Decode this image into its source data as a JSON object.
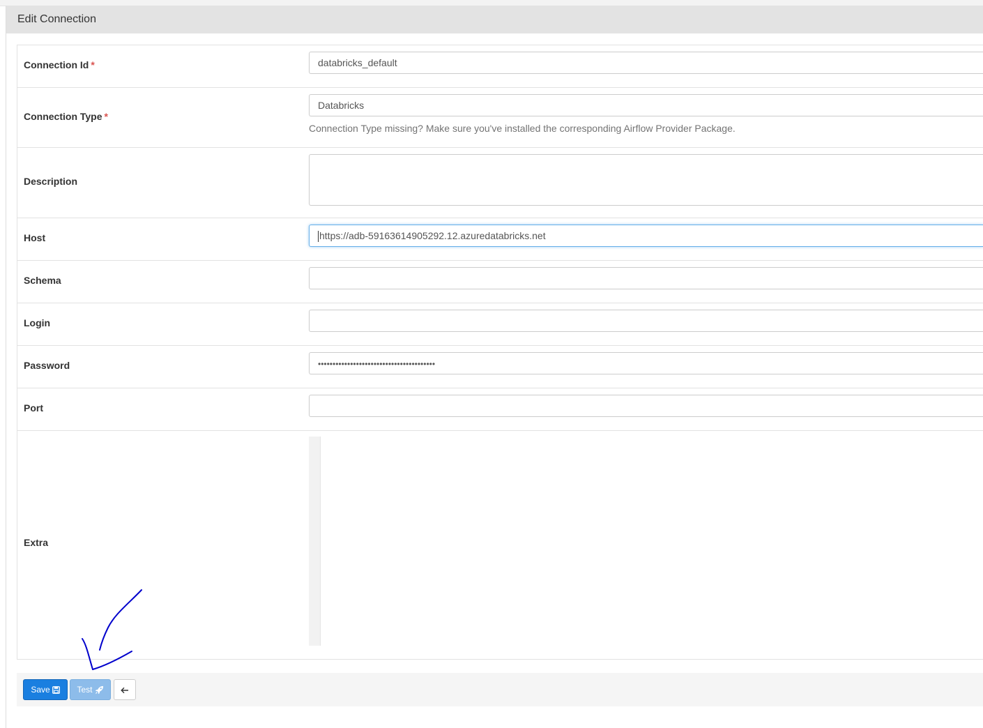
{
  "panel": {
    "title": "Edit Connection"
  },
  "fields": {
    "connection_id": {
      "label": "Connection Id",
      "required": "*",
      "value": "databricks_default"
    },
    "connection_type": {
      "label": "Connection Type",
      "required": "*",
      "value": "Databricks",
      "help": "Connection Type missing? Make sure you've installed the corresponding Airflow Provider Package."
    },
    "description": {
      "label": "Description",
      "value": ""
    },
    "host": {
      "label": "Host",
      "value": "https://adb-59163614905292.12.azuredatabricks.net"
    },
    "schema": {
      "label": "Schema",
      "value": ""
    },
    "login": {
      "label": "Login",
      "value": ""
    },
    "password": {
      "label": "Password",
      "value": "••••••••••••••••••••••••••••••••••••••••"
    },
    "port": {
      "label": "Port",
      "value": ""
    },
    "extra": {
      "label": "Extra",
      "value": ""
    }
  },
  "actions": {
    "save_label": "Save",
    "test_label": "Test",
    "save_icon": "floppy-disk-icon",
    "test_icon": "rocket-icon",
    "back_icon": "arrow-left-icon"
  },
  "colors": {
    "primary": "#1a7fe0",
    "primary_disabled": "#8dbcea",
    "required": "#d9534f",
    "annotation": "#0000cc",
    "heading_bg": "#e3e3e3"
  }
}
